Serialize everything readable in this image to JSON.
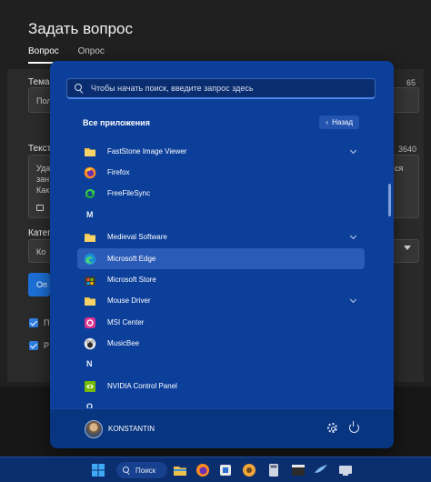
{
  "background_page": {
    "title": "Задать вопрос",
    "tabs": [
      {
        "label": "Вопрос",
        "active": true
      },
      {
        "label": "Опрос",
        "active": false
      }
    ],
    "fields": {
      "topic_label": "Тема",
      "topic_counter": "65",
      "topic_value": "Пол",
      "text_label": "Текст",
      "text_counter": "3640",
      "text_lines": [
        "Уда",
        "зан",
        "Как"
      ],
      "text_right_fragment": "ся",
      "category_label": "Катег",
      "category_value": "Ко"
    },
    "button_label": "Оп",
    "checkbox_labels": [
      "П",
      "Р"
    ]
  },
  "start_menu": {
    "search_placeholder": "Чтобы начать поиск, введите запрос здесь",
    "all_apps_label": "Все приложения",
    "back_label": "Назад",
    "items": [
      {
        "type": "app",
        "name": "FastStone Image Viewer",
        "icon": "folder-icon",
        "expandable": true
      },
      {
        "type": "app",
        "name": "Firefox",
        "icon": "firefox-icon"
      },
      {
        "type": "app",
        "name": "FreeFileSync",
        "icon": "sync-icon"
      },
      {
        "type": "letter",
        "name": "M"
      },
      {
        "type": "app",
        "name": "Medieval Software",
        "icon": "folder-icon",
        "expandable": true
      },
      {
        "type": "app",
        "name": "Microsoft Edge",
        "icon": "edge-icon",
        "selected": true
      },
      {
        "type": "app",
        "name": "Microsoft Store",
        "icon": "store-icon"
      },
      {
        "type": "app",
        "name": "Mouse Driver",
        "icon": "folder-icon",
        "expandable": true
      },
      {
        "type": "app",
        "name": "MSI Center",
        "icon": "msi-icon"
      },
      {
        "type": "app",
        "name": "MusicBee",
        "icon": "musicbee-icon"
      },
      {
        "type": "letter",
        "name": "N"
      },
      {
        "type": "app",
        "name": "NVIDIA Control Panel",
        "icon": "nvidia-icon"
      },
      {
        "type": "letter",
        "name": "O"
      }
    ],
    "user_name": "KONSTANTIN"
  },
  "taskbar": {
    "search_label": "Поиск",
    "icons": [
      "windows-start-icon",
      "taskbar-search",
      "file-explorer-icon",
      "firefox-icon",
      "app-icon",
      "app-icon-2",
      "calculator-icon",
      "media-icon",
      "video-icon",
      "browser-icon",
      "network-icon"
    ]
  },
  "colors": {
    "menu_bg": "#0b3f9a",
    "accent": "#2a5bb6",
    "taskbar_bg": "#0b2e6e"
  }
}
